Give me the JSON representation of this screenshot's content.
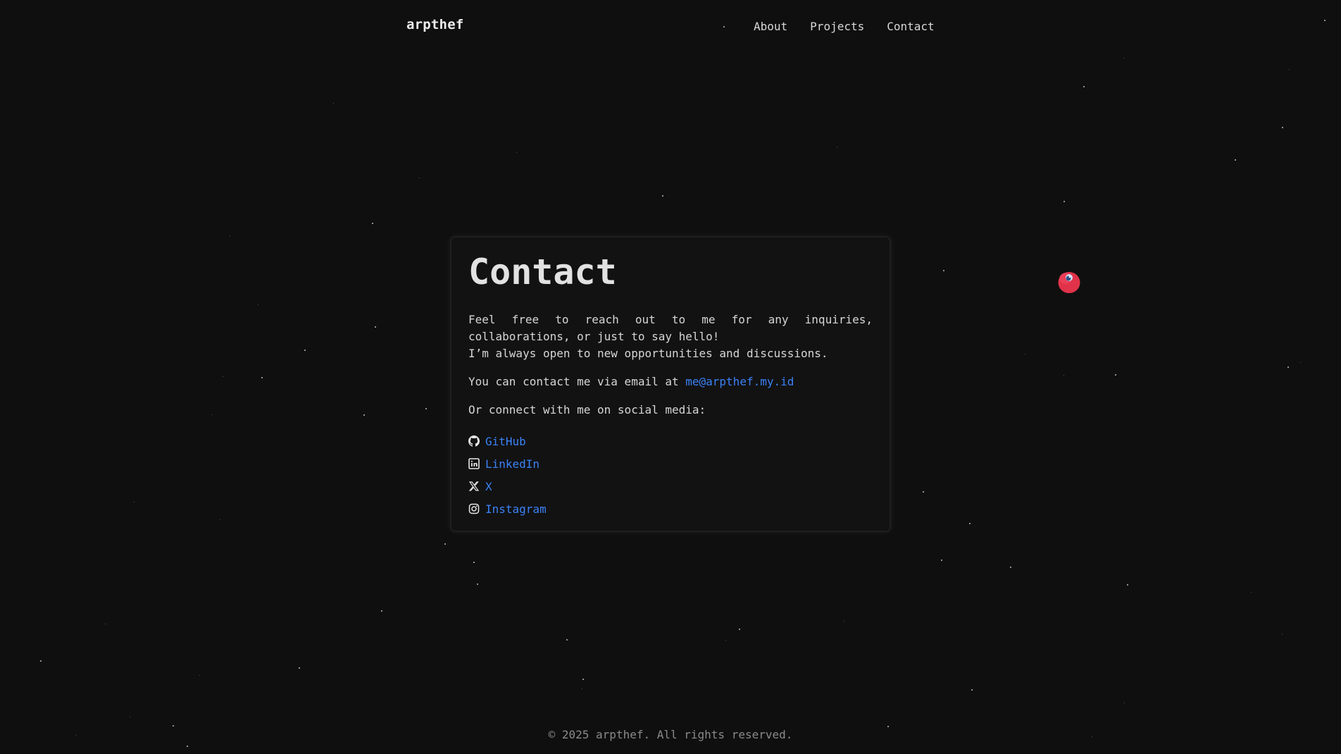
{
  "header": {
    "brand": "arpthef",
    "nav": [
      "About",
      "Projects",
      "Contact"
    ]
  },
  "contact": {
    "title": "Contact",
    "intro_line1": "Feel free to reach out to me for any inquiries, collaborations, or just to say hello!",
    "intro_line2": "I’m always open to new opportunities and discussions.",
    "email_prefix": "You can contact me via email at ",
    "email": "me@arpthef.my.id",
    "social_prompt": "Or connect with me on social media:",
    "socials": [
      {
        "label": "GitHub",
        "icon": "github-icon"
      },
      {
        "label": "LinkedIn",
        "icon": "linkedin-icon"
      },
      {
        "label": "X",
        "icon": "x-icon"
      },
      {
        "label": "Instagram",
        "icon": "instagram-icon"
      }
    ]
  },
  "footer": {
    "text": "© 2025 arpthef. All rights reserved."
  },
  "colors": {
    "background": "#0f0f0f",
    "link": "#3b82f6",
    "ball": "#e0334a"
  }
}
